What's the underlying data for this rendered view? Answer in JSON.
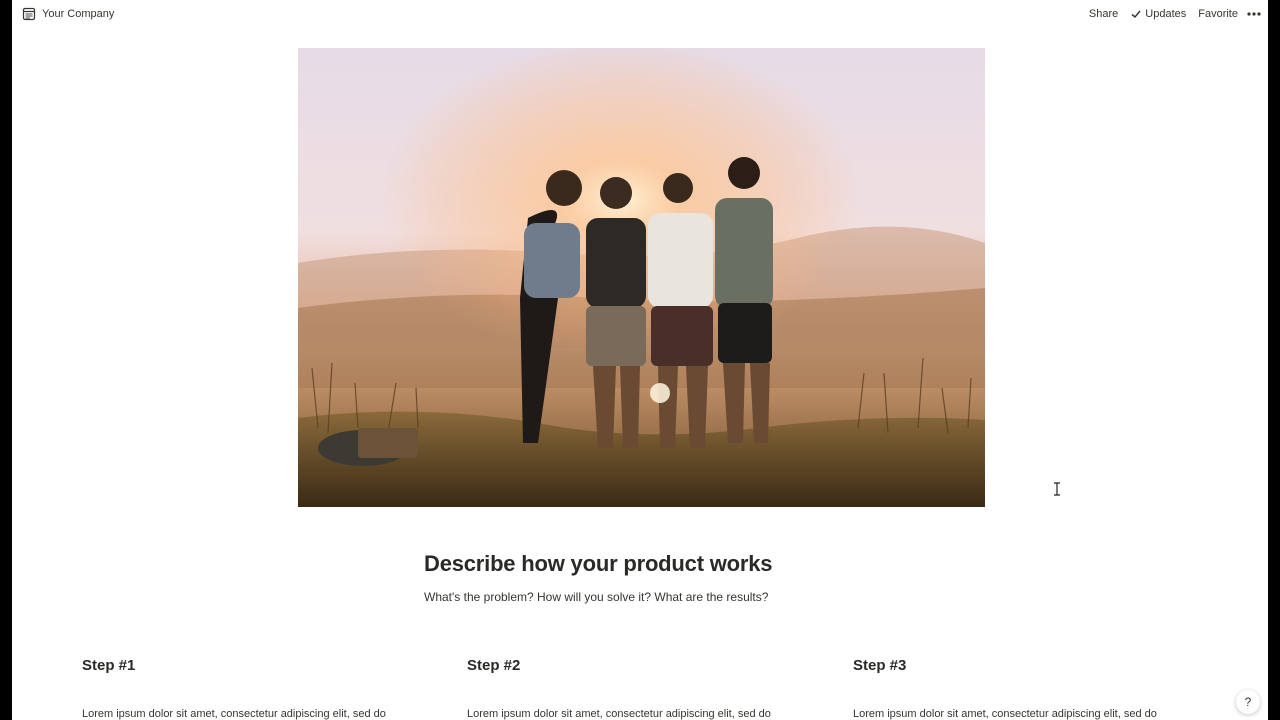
{
  "topbar": {
    "workspace_icon": "page-icon",
    "workspace_name": "Your Company",
    "share_label": "Share",
    "updates_label": "Updates",
    "favorite_label": "Favorite",
    "more_icon": "more-horizontal-icon"
  },
  "hero": {
    "image_icon": "hero-photo"
  },
  "content": {
    "title": "Describe how your product works",
    "subtitle": "What's the problem? How will you solve it? What are the results?",
    "steps": [
      {
        "title": "Step #1",
        "text": "Lorem ipsum dolor sit amet, consectetur adipiscing elit, sed do"
      },
      {
        "title": "Step #2",
        "text": "Lorem ipsum dolor sit amet, consectetur adipiscing elit, sed do"
      },
      {
        "title": "Step #3",
        "text": "Lorem ipsum dolor sit amet, consectetur adipiscing elit, sed do"
      }
    ]
  },
  "help": {
    "label": "?"
  }
}
